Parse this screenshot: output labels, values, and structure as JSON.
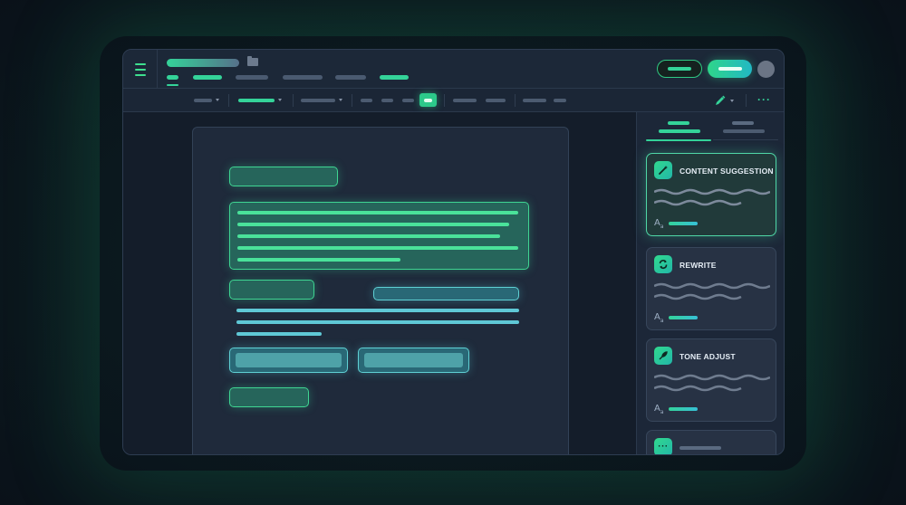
{
  "toolbar": {
    "active_tool": "selection"
  },
  "cards": [
    {
      "title": "CONTENT SUGGESTION",
      "icon": "magic-wand-icon",
      "active": true
    },
    {
      "title": "REWRITE",
      "icon": "refresh-icon",
      "active": false
    },
    {
      "title": "TONE ADJUST",
      "icon": "quill-icon",
      "active": false
    },
    {
      "title": "",
      "icon": "more-icon",
      "active": false
    }
  ],
  "colors": {
    "accent": "#34d399",
    "accent_teal": "#22b8c4",
    "background": "#0b1a1f",
    "panel": "#1b2636"
  }
}
